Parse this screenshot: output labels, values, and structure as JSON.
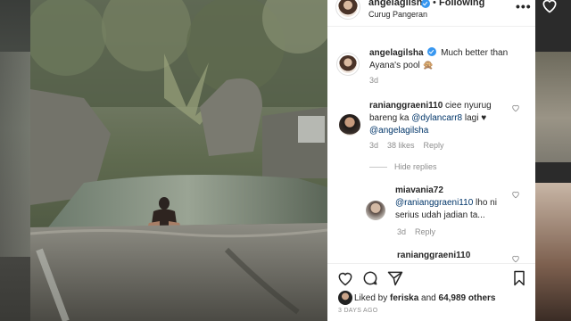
{
  "post": {
    "username": "angelagilsha",
    "follow_status": "Following",
    "separator": "•",
    "location": "Curug Pangeran",
    "more": "•••"
  },
  "caption": {
    "username": "angelagilsha",
    "text": "Much better than Ayana's pool 🙊",
    "time": "3d"
  },
  "comments": [
    {
      "username": "ranianggraeni110",
      "text_before": "ciee nyurug bareng ka ",
      "mention1": "@dylancarr8",
      "text_mid": " lagi ♥ ",
      "mention2": "@angelagilsha",
      "time": "3d",
      "likes": "38 likes",
      "reply": "Reply",
      "hide_replies": "Hide replies"
    }
  ],
  "replies": [
    {
      "username": "miavania72",
      "mention": "@ranianggraeni110",
      "text": " lho ni serius udah jadian ta...",
      "time": "3d",
      "reply": "Reply"
    },
    {
      "username": "ranianggraeni110"
    }
  ],
  "footer": {
    "liked_by_prefix": "Liked by ",
    "liked_by_user": "feriska",
    "liked_by_mid": " and ",
    "liked_by_count": "64,989 others",
    "time_ago": "3 DAYS AGO"
  },
  "icons": {
    "like": "heart-icon",
    "comment": "comment-icon",
    "share": "share-icon",
    "save": "bookmark-icon",
    "verified": "verified-badge-icon"
  },
  "colors": {
    "verified": "#3897f0",
    "meta": "#8e8e8e",
    "mention": "#003569"
  }
}
